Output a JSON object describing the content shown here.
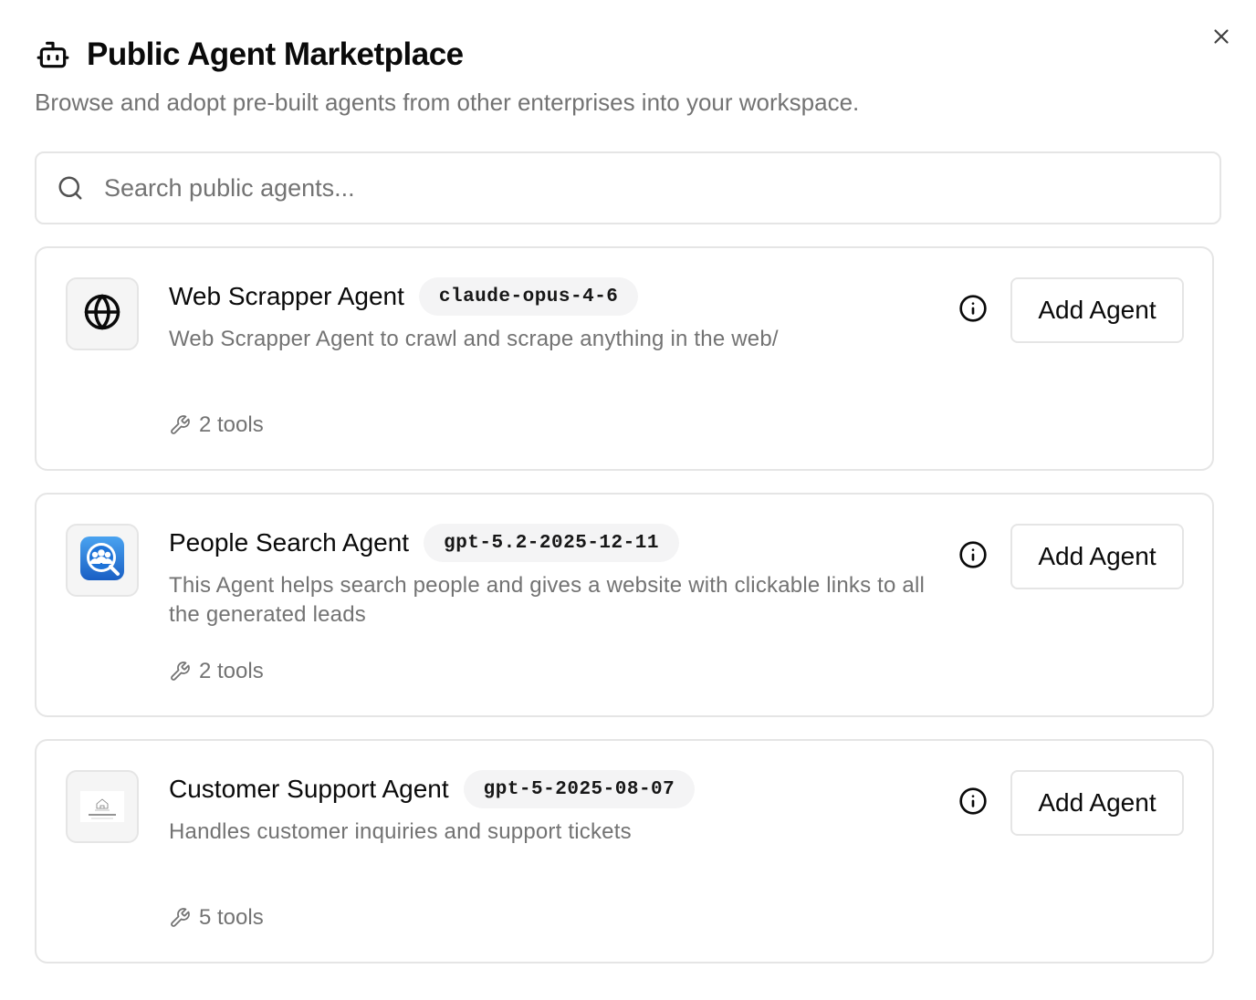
{
  "dialog": {
    "title": "Public Agent Marketplace",
    "subtitle": "Browse and adopt pre-built agents from other enterprises into your workspace.",
    "close_icon": "close-icon",
    "header_icon": "bot-icon"
  },
  "search": {
    "placeholder": "Search public agents...",
    "value": "",
    "icon": "search-icon"
  },
  "agents": [
    {
      "name": "Web Scrapper Agent",
      "model": "claude-opus-4-6",
      "description": "Web Scrapper Agent to crawl and scrape anything in the web/",
      "tools": "2 tools",
      "avatar_icon": "globe-icon",
      "add_label": "Add Agent",
      "info_icon": "info-icon"
    },
    {
      "name": "People Search Agent",
      "model": "gpt-5.2-2025-12-11",
      "description": "This Agent helps search people and gives a website with clickable links to all the generated leads",
      "tools": "2 tools",
      "avatar_icon": "people-search-icon",
      "add_label": "Add Agent",
      "info_icon": "info-icon"
    },
    {
      "name": "Customer Support Agent",
      "model": "gpt-5-2025-08-07",
      "description": "Handles customer inquiries and support tickets",
      "tools": "5 tools",
      "avatar_icon": "company-logo",
      "add_label": "Add Agent",
      "info_icon": "info-icon"
    }
  ],
  "colors": {
    "border": "#e5e5e5",
    "muted_text": "#737373",
    "badge_bg": "#f4f4f5",
    "people_icon_blue": "#1e73d8"
  }
}
